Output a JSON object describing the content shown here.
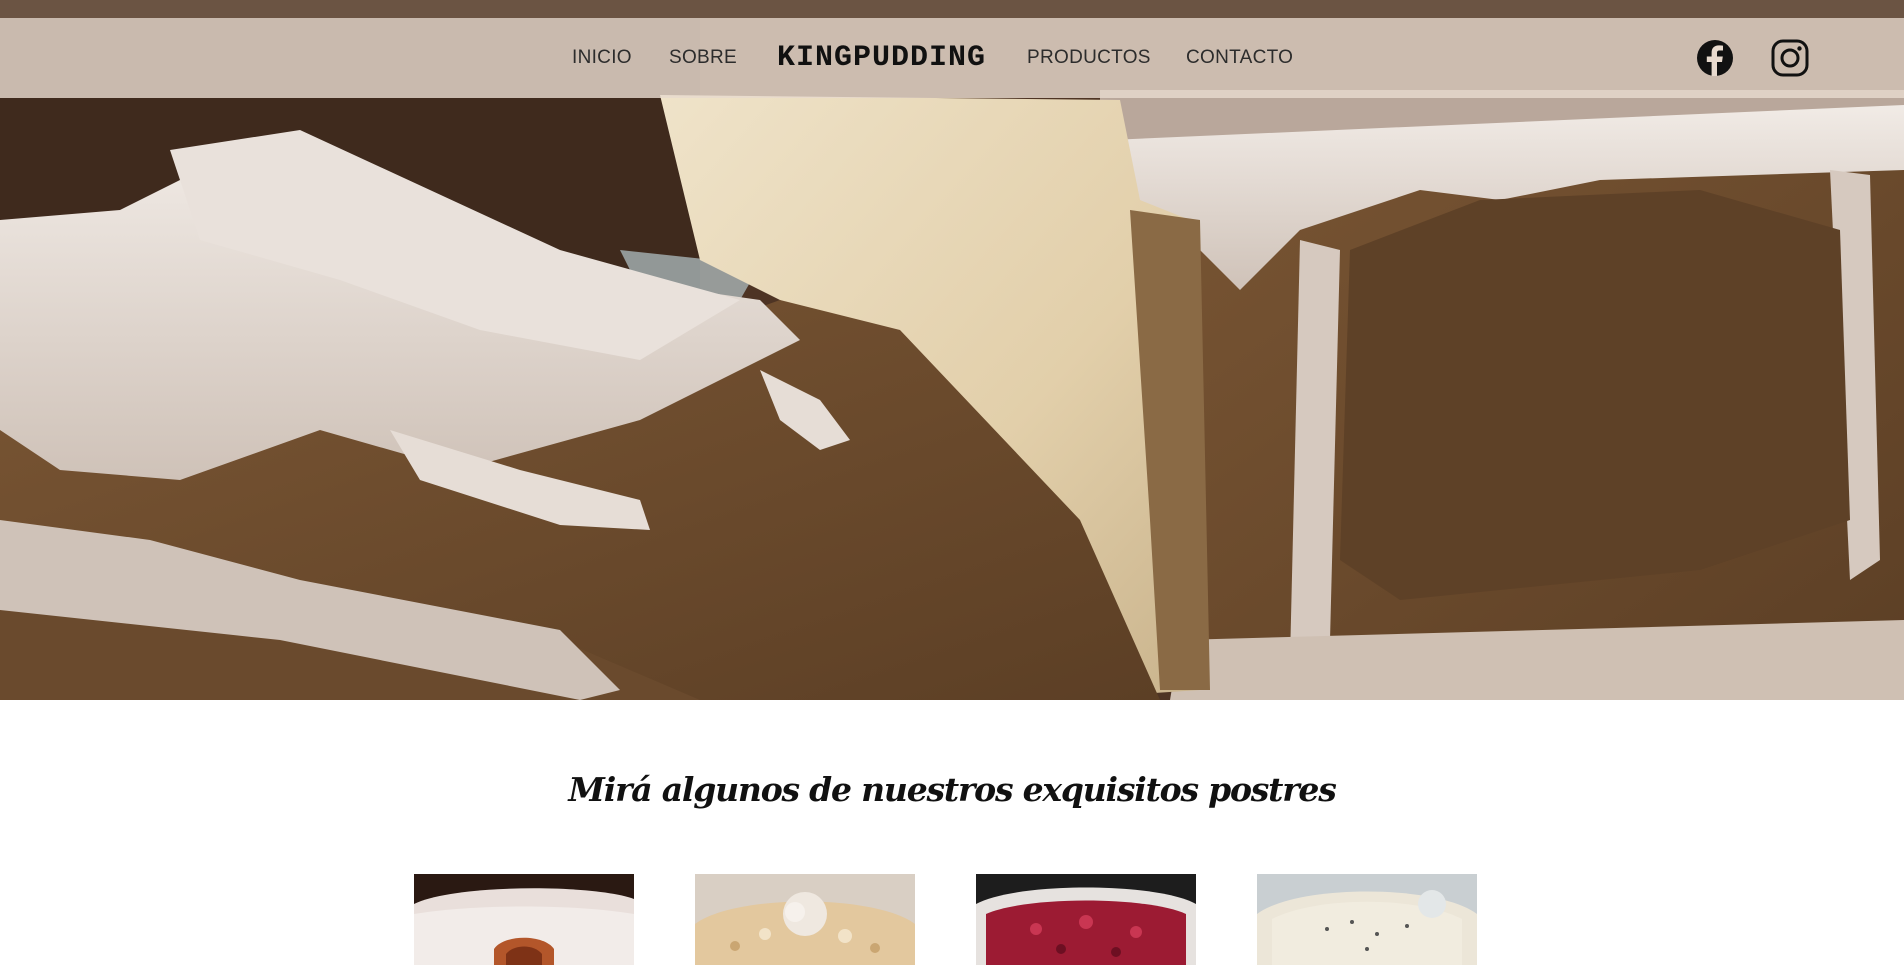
{
  "nav": {
    "links_left": [
      "INICIO",
      "SOBRE"
    ],
    "brand": "KINGPUDDING",
    "links_right": [
      "PRODUCTOS",
      "CONTACTO"
    ],
    "social": [
      {
        "name": "facebook",
        "icon": "facebook-icon"
      },
      {
        "name": "instagram",
        "icon": "instagram-icon"
      }
    ]
  },
  "hero": {
    "image": "pound-cake-with-icing-photo"
  },
  "products": {
    "title": "Mirá algunos de nuestros exquisitos postres",
    "items": [
      {
        "image": "glazed-bundt-cake-photo"
      },
      {
        "image": "meringue-crumb-cake-photo"
      },
      {
        "image": "berry-cheesecake-photo"
      },
      {
        "image": "white-frosted-cake-photo"
      }
    ]
  },
  "colors": {
    "nav_bg": "#e8dace",
    "text": "#2c2c2c",
    "brand": "#111111",
    "cake_crumb": "#e6d5b4",
    "cake_crust": "#6a4a2d",
    "icing": "#d8ccc3"
  }
}
